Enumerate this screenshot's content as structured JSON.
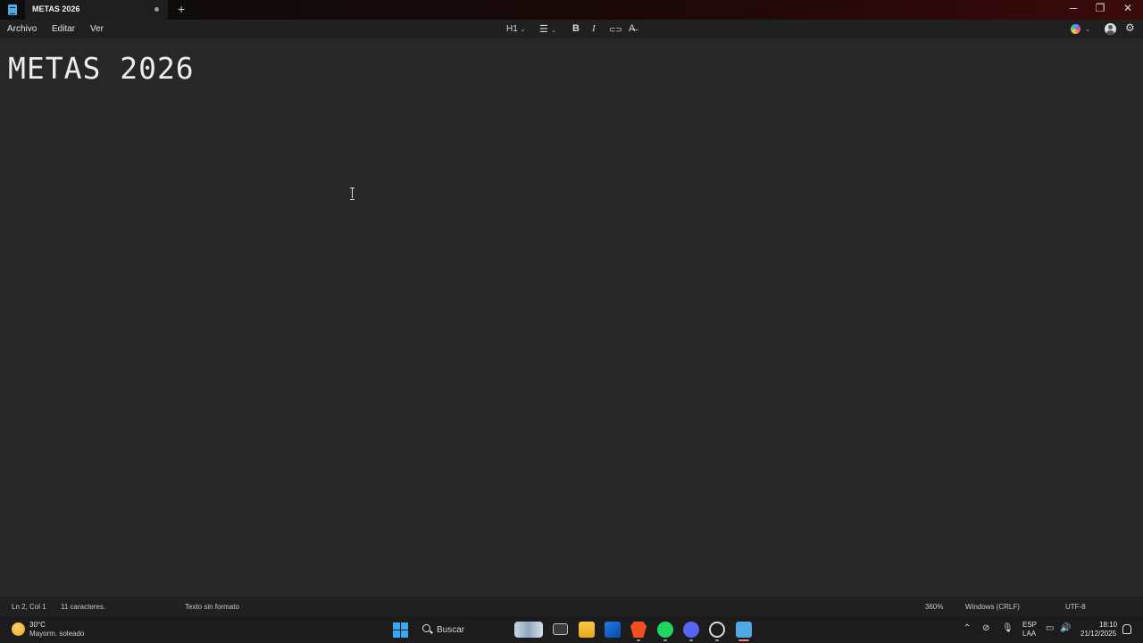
{
  "window": {
    "tab_title": "METAS 2026",
    "new_tab": "+",
    "controls": {
      "minimize": "─",
      "maximize": "❐",
      "close": "✕"
    }
  },
  "menu": {
    "file": "Archivo",
    "edit": "Editar",
    "view": "Ver"
  },
  "toolbar": {
    "heading": "H1",
    "list": "☰",
    "bold": "B",
    "italic": "I",
    "link": "⊂⊃",
    "clear_format": "A̶",
    "chevron": "⌄"
  },
  "document": {
    "heading": "METAS 2026"
  },
  "status": {
    "position": "Ln 2, Col 1",
    "char_count": "11 caracteres.",
    "format": "Texto sin formato",
    "zoom": "360%",
    "line_ending": "Windows (CRLF)",
    "encoding": "UTF-8"
  },
  "taskbar": {
    "weather_temp": "30°C",
    "weather_desc": "Mayorm. soleado",
    "search_placeholder": "Buscar",
    "tray_chevron": "⌃",
    "lang_1": "ESP",
    "lang_2": "LAA",
    "time": "18:10",
    "date": "21/12/2025",
    "apps": [
      "task-view",
      "file-explorer",
      "outlook",
      "brave",
      "spotify",
      "discord",
      "chatgpt",
      "notepad"
    ]
  }
}
